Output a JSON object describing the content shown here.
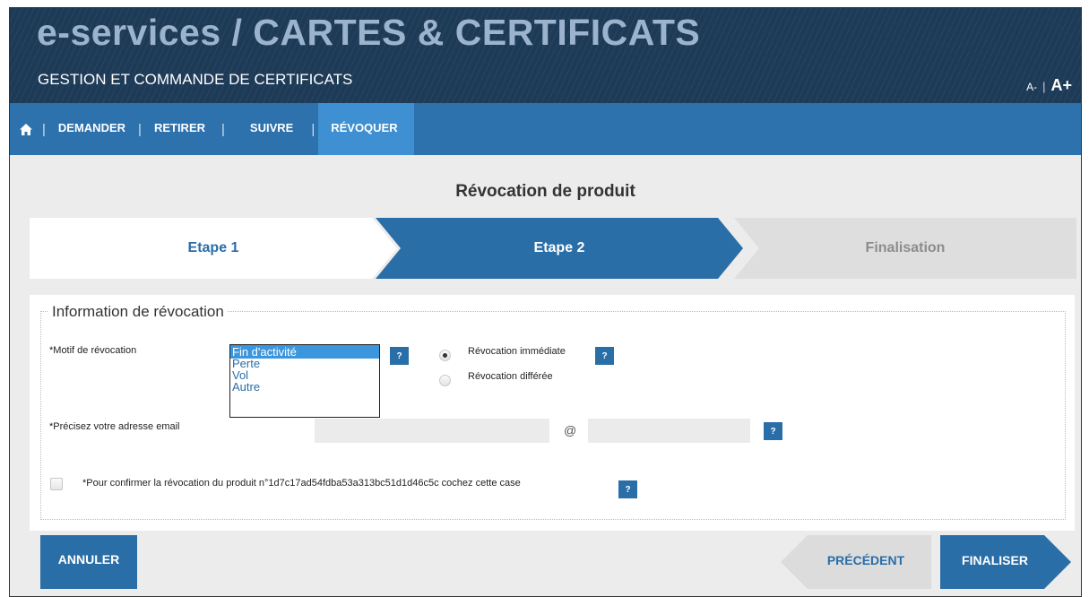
{
  "header": {
    "title": "e-services / CARTES & CERTIFICATS",
    "subtitle": "GESTION ET COMMANDE DE CERTIFICATS",
    "font_decrease": "A-",
    "font_separator": "|",
    "font_increase": "A+"
  },
  "nav": {
    "home_icon": "home-icon",
    "separator": "|",
    "items": [
      {
        "label": "DEMANDER"
      },
      {
        "label": "RETIRER"
      },
      {
        "label": "SUIVRE"
      },
      {
        "label": "RÉVOQUER"
      }
    ],
    "active_index": 3
  },
  "page_title": "Révocation de produit",
  "steps": [
    {
      "label": "Etape 1",
      "state": "done"
    },
    {
      "label": "Etape 2",
      "state": "current"
    },
    {
      "label": "Finalisation",
      "state": "pending"
    }
  ],
  "form": {
    "legend": "Information de révocation",
    "reason": {
      "label": "*Motif de révocation",
      "options": [
        "Fin d'activité",
        "Perte",
        "Vol",
        "Autre"
      ],
      "selected": "Fin d'activité"
    },
    "revocation_type": {
      "options": [
        "Révocation immédiate",
        "Révocation différée"
      ],
      "selected": "Révocation immédiate"
    },
    "email": {
      "label": "*Précisez votre adresse email",
      "user_value": "",
      "at": "@",
      "domain_value": ""
    },
    "confirm": {
      "label": "*Pour confirmer la révocation du produit n°1d7c17ad54fdba53a313bc51d1d46c5c cochez cette case",
      "checked": false
    },
    "help_label": "?"
  },
  "buttons": {
    "cancel": "ANNULER",
    "previous": "PRÉCÉDENT",
    "finish": "FINALISER"
  },
  "colors": {
    "banner": "#1d3a57",
    "nav": "#2d72ad",
    "nav_active": "#3f90d2",
    "primary": "#2a6ea8",
    "step_pending": "#dedede"
  }
}
